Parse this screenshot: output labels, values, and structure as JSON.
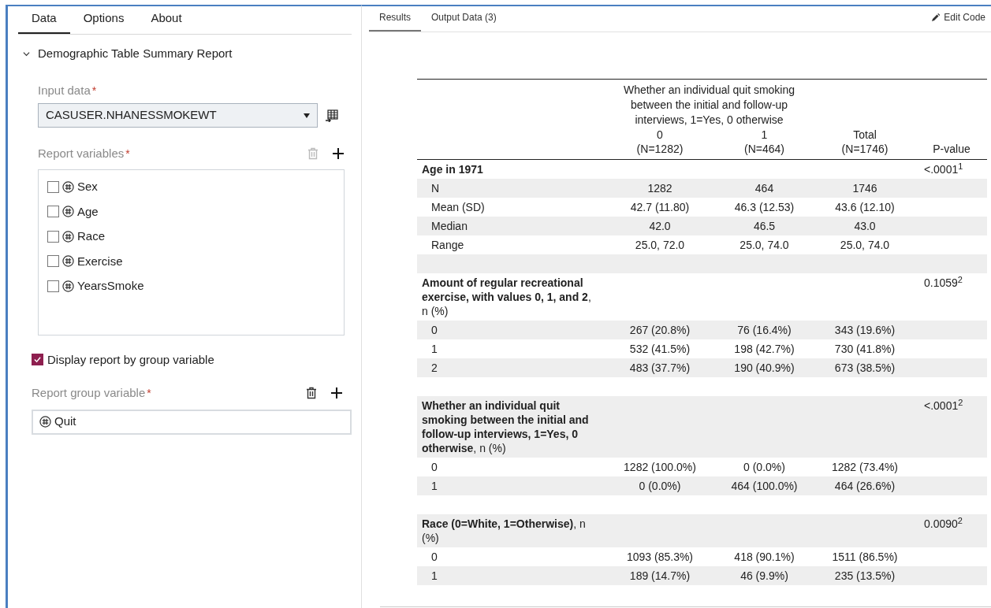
{
  "left_panel": {
    "tabs": [
      {
        "label": "Data",
        "selected": true
      },
      {
        "label": "Options",
        "selected": false
      },
      {
        "label": "About",
        "selected": false
      }
    ],
    "section": {
      "title": "Demographic Table Summary Report",
      "expanded": true
    },
    "input_data": {
      "label": "Input data",
      "required_mark": "*",
      "value": "CASUSER.NHANESSMOKEWT"
    },
    "report_variables": {
      "label": "Report variables",
      "required_mark": "*",
      "items": [
        {
          "name": "Sex",
          "checked": false
        },
        {
          "name": "Age",
          "checked": false
        },
        {
          "name": "Race",
          "checked": false
        },
        {
          "name": "Exercise",
          "checked": false
        },
        {
          "name": "YearsSmoke",
          "checked": false
        }
      ]
    },
    "group_option": {
      "label": "Display report by group variable",
      "checked": true
    },
    "group_variable": {
      "label": "Report group variable",
      "required_mark": "*",
      "items": [
        "Quit"
      ]
    }
  },
  "right_panel": {
    "tabs": [
      {
        "label": "Results",
        "selected": true
      },
      {
        "label": "Output Data (3)",
        "selected": false
      }
    ],
    "edit_button": "Edit Code",
    "table": {
      "spanner": "Whether an individual quit smoking between the initial and follow-up interviews, 1=Yes, 0 otherwise",
      "columns": [
        {
          "line1": "0",
          "line2": "(N=1282)"
        },
        {
          "line1": "1",
          "line2": "(N=464)"
        },
        {
          "line1": "Total",
          "line2": "(N=1746)"
        },
        {
          "line2": "P-value"
        }
      ],
      "rows": [
        {
          "kind": "heading",
          "label": "**Age in 1971**",
          "p": "<.0001$^{1}$",
          "shaded": false
        },
        {
          "kind": "stat",
          "label": "N",
          "values": [
            "1282",
            "464",
            "1746"
          ],
          "shaded": true
        },
        {
          "kind": "stat",
          "label": "Mean (SD)",
          "values": [
            "42.7 (11.80)",
            "46.3 (12.53)",
            "43.6 (12.10)"
          ],
          "shaded": false
        },
        {
          "kind": "stat",
          "label": "Median",
          "values": [
            "42.0",
            "46.5",
            "43.0"
          ],
          "shaded": true
        },
        {
          "kind": "stat",
          "label": "Range",
          "values": [
            "25.0, 72.0",
            "25.0, 74.0",
            "25.0, 74.0"
          ],
          "shaded": false
        },
        {
          "kind": "spacer",
          "shaded": true
        },
        {
          "kind": "heading",
          "label": "**Amount of regular recreational exercise, with values 0, 1, and 2**, n (%)",
          "p": "0.1059$^{2}$",
          "shaded": false
        },
        {
          "kind": "stat",
          "label": "0",
          "values": [
            "267 (20.8%)",
            "76 (16.4%)",
            "343 (19.6%)"
          ],
          "shaded": true
        },
        {
          "kind": "stat",
          "label": "1",
          "values": [
            "532 (41.5%)",
            "198 (42.7%)",
            "730 (41.8%)"
          ],
          "shaded": false
        },
        {
          "kind": "stat",
          "label": "2",
          "values": [
            "483 (37.7%)",
            "190 (40.9%)",
            "673 (38.5%)"
          ],
          "shaded": true
        },
        {
          "kind": "spacer"
        },
        {
          "kind": "heading",
          "label": "**Whether an individual quit smoking between the initial and follow-up interviews, 1=Yes, 0 otherwise**, n (%)",
          "p": "<.0001$^{2}$",
          "shaded": true
        },
        {
          "kind": "stat",
          "label": "0",
          "values": [
            "1282 (100.0%)",
            "0 (0.0%)",
            "1282 (73.4%)"
          ],
          "shaded": false
        },
        {
          "kind": "stat",
          "label": "1",
          "values": [
            "0 (0.0%)",
            "464 (100.0%)",
            "464 (26.6%)"
          ],
          "shaded": true
        },
        {
          "kind": "spacer"
        },
        {
          "kind": "heading",
          "label": "**Race (0=White, 1=Otherwise)**, n (%)",
          "p": "0.0090$^{2}$",
          "shaded": true
        },
        {
          "kind": "stat",
          "label": "0",
          "values": [
            "1093 (85.3%)",
            "418 (90.1%)",
            "1511 (86.5%)"
          ],
          "shaded": false
        },
        {
          "kind": "stat",
          "label": "1",
          "values": [
            "189 (14.7%)",
            "46 (9.9%)",
            "235 (13.5%)"
          ],
          "shaded": true
        }
      ]
    }
  }
}
